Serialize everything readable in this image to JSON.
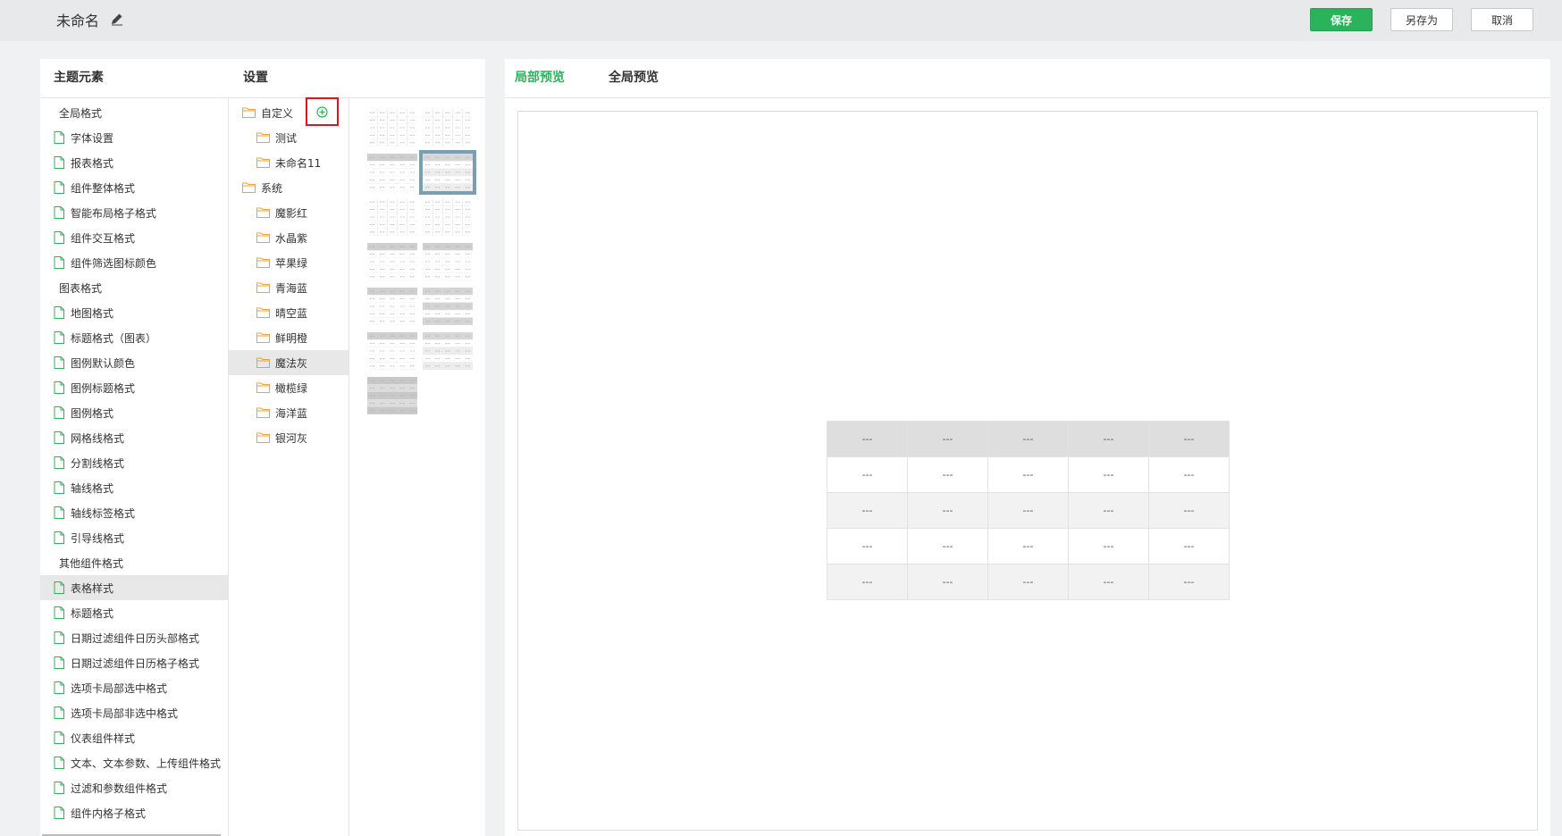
{
  "header": {
    "doc_title": "未命名",
    "save_label": "保存",
    "save_as_label": "另存为",
    "cancel_label": "取消",
    "accent_color": "#2bb35b"
  },
  "left_panel": {
    "elements_header": "主题元素",
    "settings_header": "设置",
    "elements": [
      {
        "label": "全局格式",
        "type": "group"
      },
      {
        "label": "字体设置",
        "type": "leaf"
      },
      {
        "label": "报表格式",
        "type": "leaf"
      },
      {
        "label": "组件整体格式",
        "type": "leaf"
      },
      {
        "label": "智能布局格子格式",
        "type": "leaf"
      },
      {
        "label": "组件交互格式",
        "type": "leaf"
      },
      {
        "label": "组件筛选图标颜色",
        "type": "leaf"
      },
      {
        "label": "图表格式",
        "type": "group"
      },
      {
        "label": "地图格式",
        "type": "leaf"
      },
      {
        "label": "标题格式（图表）",
        "type": "leaf"
      },
      {
        "label": "图例默认颜色",
        "type": "leaf"
      },
      {
        "label": "图例标题格式",
        "type": "leaf"
      },
      {
        "label": "图例格式",
        "type": "leaf"
      },
      {
        "label": "网格线格式",
        "type": "leaf"
      },
      {
        "label": "分割线格式",
        "type": "leaf"
      },
      {
        "label": "轴线格式",
        "type": "leaf"
      },
      {
        "label": "轴线标签格式",
        "type": "leaf"
      },
      {
        "label": "引导线格式",
        "type": "leaf"
      },
      {
        "label": "其他组件格式",
        "type": "group"
      },
      {
        "label": "表格样式",
        "type": "leaf",
        "selected": true
      },
      {
        "label": "标题格式",
        "type": "leaf"
      },
      {
        "label": "日期过滤组件日历头部格式",
        "type": "leaf"
      },
      {
        "label": "日期过滤组件日历格子格式",
        "type": "leaf"
      },
      {
        "label": "选项卡局部选中格式",
        "type": "leaf"
      },
      {
        "label": "选项卡局部非选中格式",
        "type": "leaf"
      },
      {
        "label": "仪表组件样式",
        "type": "leaf"
      },
      {
        "label": "文本、文本参数、上传组件格式",
        "type": "leaf"
      },
      {
        "label": "过滤和参数组件格式",
        "type": "leaf"
      },
      {
        "label": "组件内格子格式",
        "type": "leaf"
      }
    ],
    "folders": [
      {
        "label": "自定义",
        "level": 0,
        "add_icon": "plus-circle-icon"
      },
      {
        "label": "测试",
        "level": 1
      },
      {
        "label": "未命名11",
        "level": 1
      },
      {
        "label": "系统",
        "level": 0
      },
      {
        "label": "魔影红",
        "level": 1
      },
      {
        "label": "水晶紫",
        "level": 1
      },
      {
        "label": "苹果绿",
        "level": 1
      },
      {
        "label": "青海蓝",
        "level": 1
      },
      {
        "label": "晴空蓝",
        "level": 1
      },
      {
        "label": "鲜明橙",
        "level": 1
      },
      {
        "label": "魔法灰",
        "level": 1,
        "selected": true
      },
      {
        "label": "橄榄绿",
        "level": 1
      },
      {
        "label": "海洋蓝",
        "level": 1
      },
      {
        "label": "银河灰",
        "level": 1
      }
    ],
    "thumbnail_styles": [
      "lined",
      "lined",
      "header-dark",
      "header-stripe-selected",
      "plain",
      "plain-light",
      "header-dark",
      "header-dark",
      "header-dark-bold",
      "striped",
      "header-dark",
      "header-stripe",
      "full-dark"
    ]
  },
  "right_panel": {
    "tab_local": "局部预览",
    "tab_global": "全局预览",
    "preview_table": {
      "rows": [
        [
          "---",
          "---",
          "---",
          "---",
          "---"
        ],
        [
          "---",
          "---",
          "---",
          "---",
          "---"
        ],
        [
          "---",
          "---",
          "---",
          "---",
          "---"
        ],
        [
          "---",
          "---",
          "---",
          "---",
          "---"
        ],
        [
          "---",
          "---",
          "---",
          "---",
          "---"
        ]
      ]
    }
  }
}
